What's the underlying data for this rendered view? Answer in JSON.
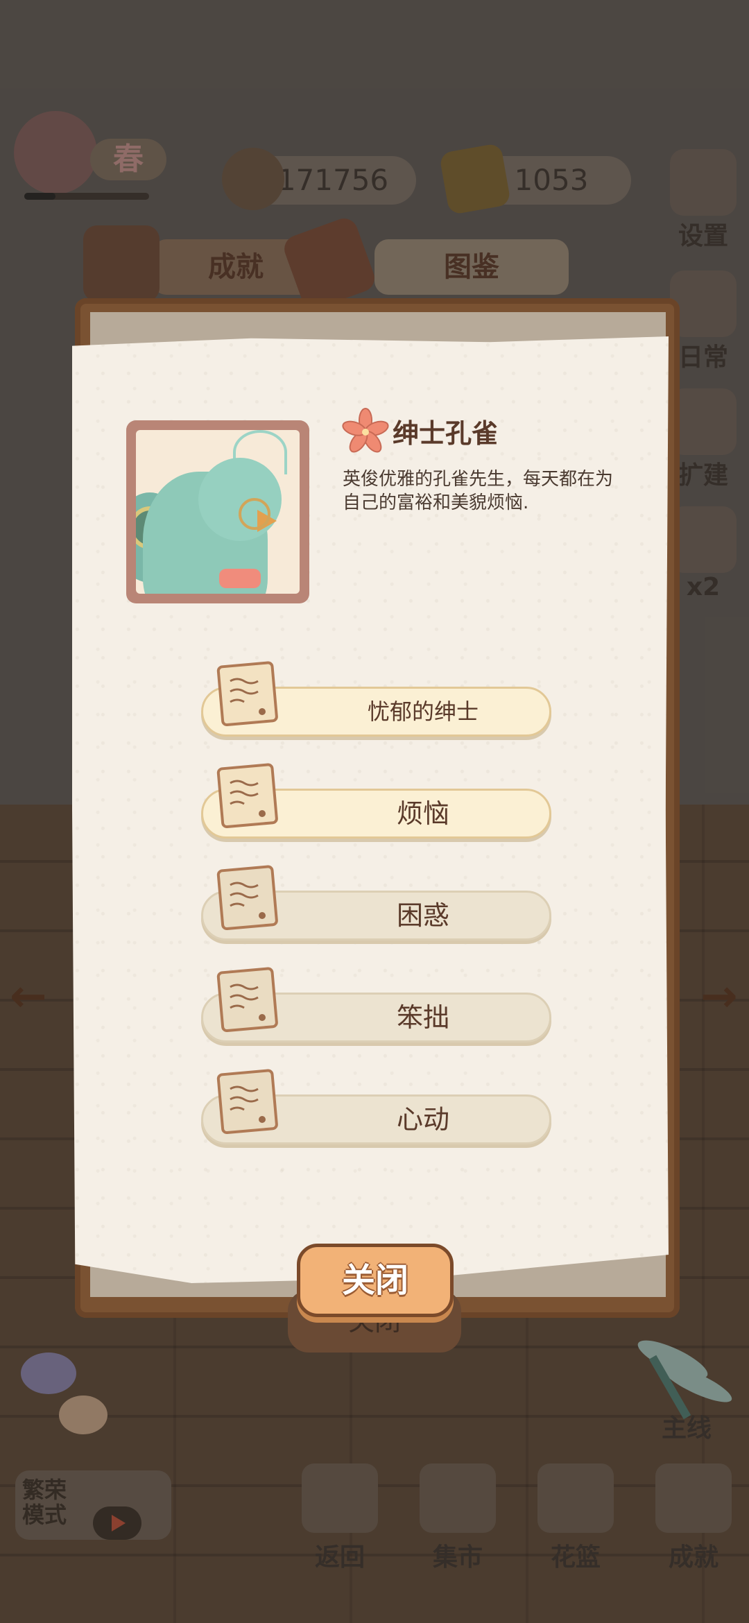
{
  "hud": {
    "season_label": "春",
    "fish_count": "171756",
    "cheese_count": "1053",
    "side_menu": [
      "设置",
      "日常",
      "扩建",
      "x2"
    ]
  },
  "tabs": {
    "achievements": "成就",
    "collection": "图鉴"
  },
  "character": {
    "name": "绅士孔雀",
    "description": "英俊优雅的孔雀先生，每天都在为自己的富裕和美貌烦恼."
  },
  "entries": [
    {
      "label": "忧郁的绅士",
      "state": "unlocked"
    },
    {
      "label": "烦恼",
      "state": "unlocked"
    },
    {
      "label": "困惑",
      "state": "locked"
    },
    {
      "label": "笨拙",
      "state": "locked"
    },
    {
      "label": "心动",
      "state": "locked"
    }
  ],
  "close_label": "关闭",
  "close_ghost_label": "关闭",
  "bottom": {
    "prosper_mode": "繁荣模式",
    "main_line": "主线",
    "nav": [
      "返回",
      "集市",
      "花篮",
      "成就"
    ]
  },
  "colors": {
    "accent": "#f2b277",
    "paper": "#f5efe6",
    "frame": "#7a5232"
  }
}
